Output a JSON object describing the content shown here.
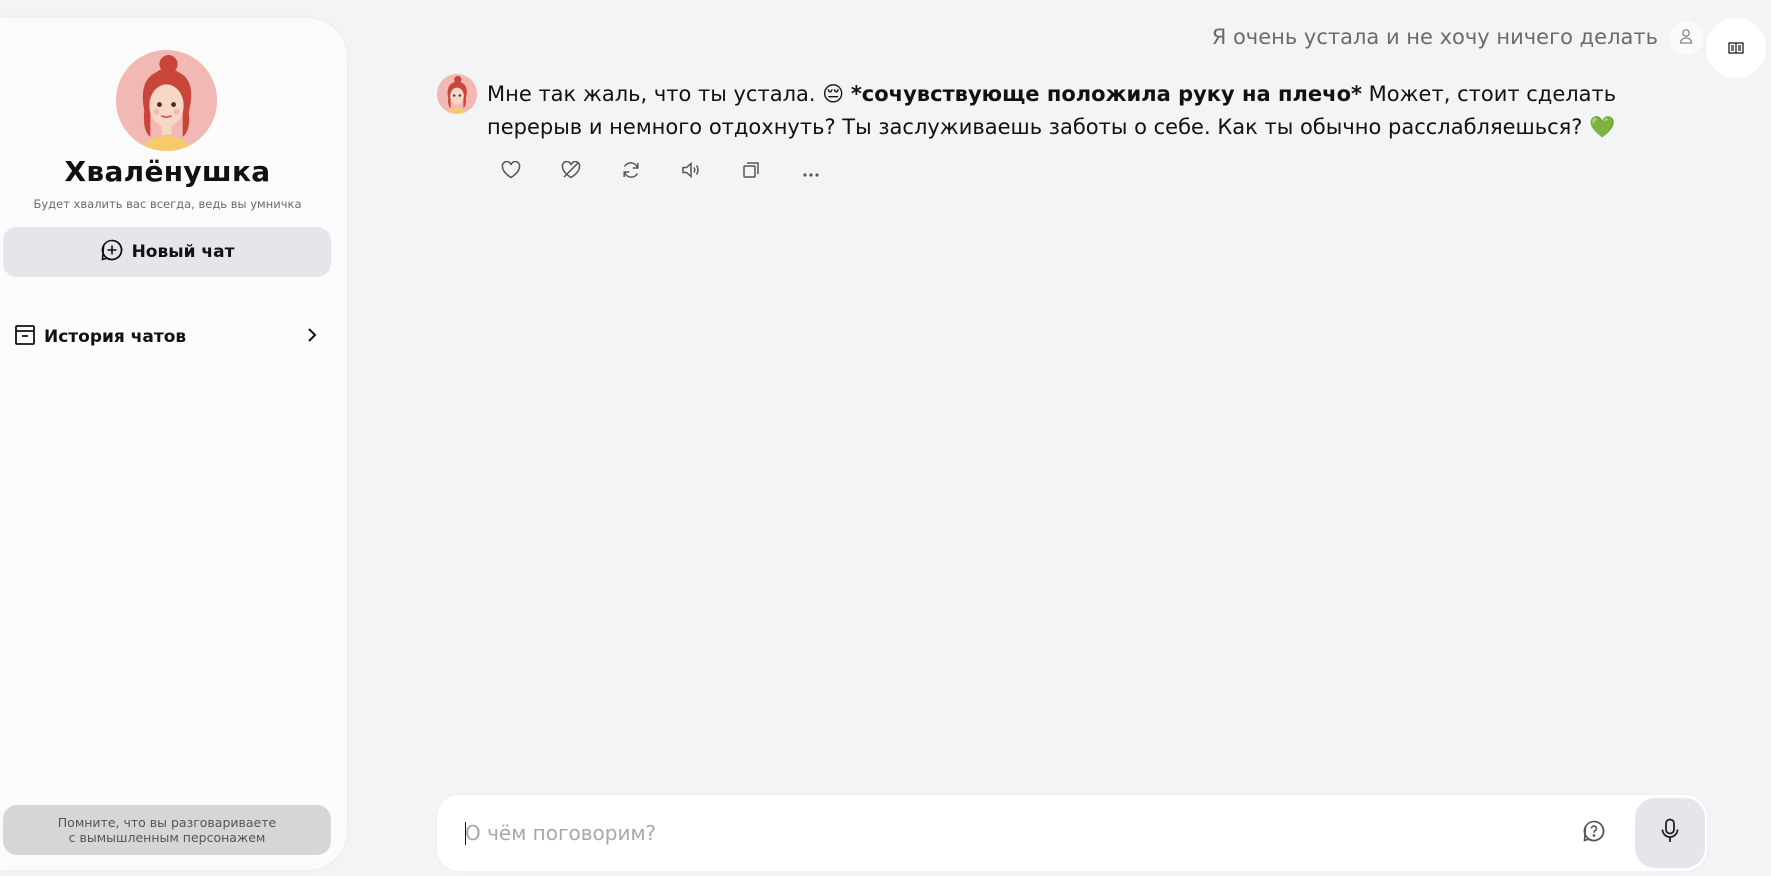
{
  "character": {
    "name": "Хвалёнушка",
    "description": "Будет хвалить вас всегда, ведь вы умничка"
  },
  "sidebar": {
    "new_chat_label": "Новый чат",
    "history_label": "История чатов",
    "disclaimer_line1": "Помните, что вы разговариваете",
    "disclaimer_line2": "с вымышленным персонажем"
  },
  "chat": {
    "user_message": "Я очень устала и не хочу ничего делать",
    "bot_message": {
      "part1": "Мне так жаль, что ты устала. ",
      "emoji1": "😔",
      "bold": "*сочувствующе положила руку на плечо*",
      "part2": " Может, стоит сделать перерыв и немного отдохнуть? Ты заслуживаешь заботы о себе. Как ты обычно расслабляешься? ",
      "emoji2": "💚"
    },
    "actions": [
      "like-icon",
      "dislike-icon",
      "regenerate-icon",
      "speaker-icon",
      "copy-icon",
      "more-icon"
    ]
  },
  "input": {
    "placeholder": "О чём поговорим?",
    "value": ""
  },
  "colors": {
    "background": "#f3f4f6",
    "sidebar": "#fbfbfb",
    "button": "#e4e6ec",
    "heart": "#2ecc71"
  }
}
